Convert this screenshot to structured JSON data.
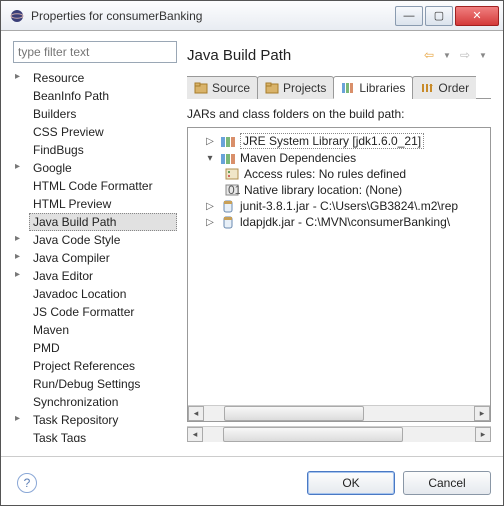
{
  "window": {
    "title": "Properties for consumerBanking"
  },
  "filter_placeholder": "type filter text",
  "nav": {
    "items": [
      {
        "label": "Resource",
        "exp": true
      },
      {
        "label": "BeanInfo Path"
      },
      {
        "label": "Builders"
      },
      {
        "label": "CSS Preview"
      },
      {
        "label": "FindBugs"
      },
      {
        "label": "Google",
        "exp": true
      },
      {
        "label": "HTML Code Formatter"
      },
      {
        "label": "HTML Preview"
      },
      {
        "label": "Java Build Path",
        "selected": true
      },
      {
        "label": "Java Code Style",
        "exp": true
      },
      {
        "label": "Java Compiler",
        "exp": true
      },
      {
        "label": "Java Editor",
        "exp": true
      },
      {
        "label": "Javadoc Location"
      },
      {
        "label": "JS Code Formatter"
      },
      {
        "label": "Maven"
      },
      {
        "label": "PMD"
      },
      {
        "label": "Project References"
      },
      {
        "label": "Run/Debug Settings"
      },
      {
        "label": "Synchronization"
      },
      {
        "label": "Task Repository",
        "exp": true
      },
      {
        "label": "Task Tags"
      }
    ]
  },
  "page_title": "Java Build Path",
  "tabs": {
    "source": "Source",
    "projects": "Projects",
    "libraries": "Libraries",
    "order": "Order"
  },
  "desc": "JARs and class folders on the build path:",
  "tree": {
    "jre": "JRE System Library [jdk1.6.0_21]",
    "maven": "Maven Dependencies",
    "access": "Access rules: No rules defined",
    "native": "Native library location: (None)",
    "junit": "junit-3.8.1.jar - C:\\Users\\GB3824\\.m2\\rep",
    "ldap": "ldapjdk.jar - C:\\MVN\\consumerBanking\\"
  },
  "buttons": {
    "ok": "OK",
    "cancel": "Cancel"
  }
}
